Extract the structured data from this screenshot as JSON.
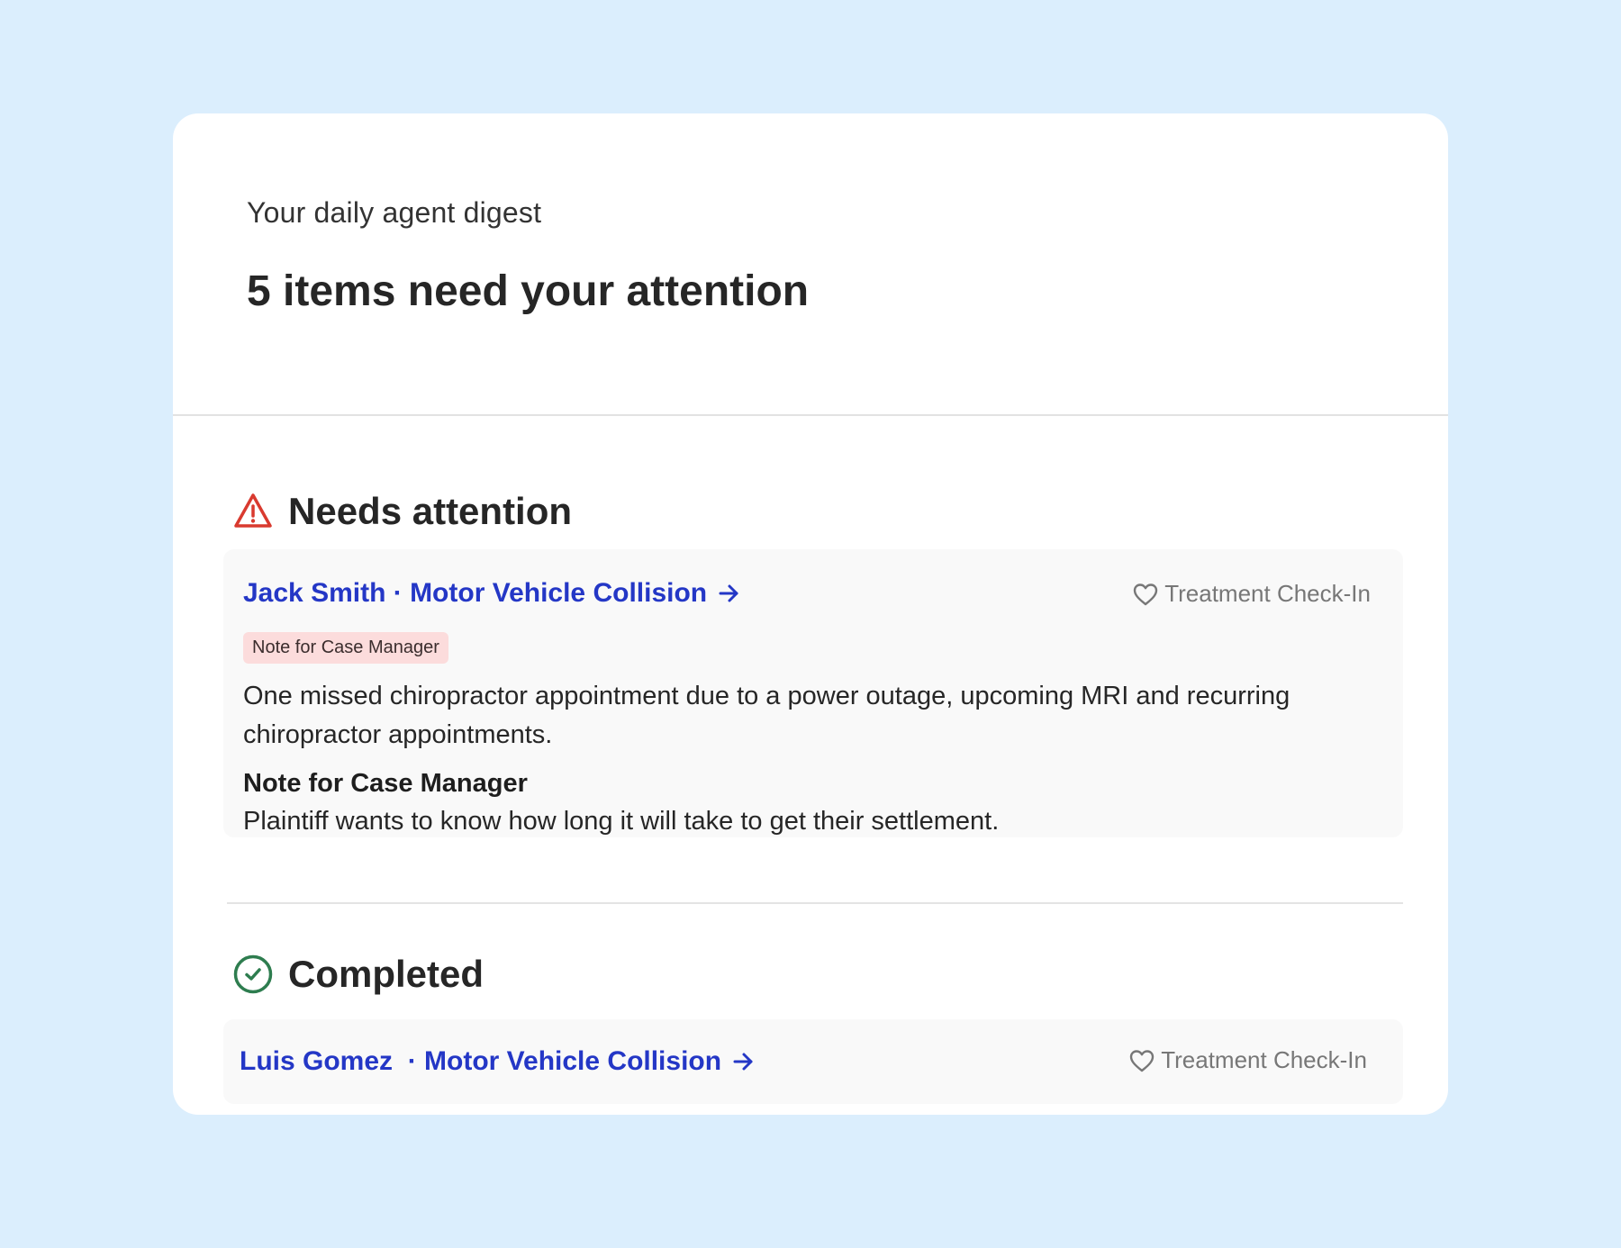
{
  "digest": {
    "subtitle": "Your daily agent digest",
    "headline": "5 items need your attention"
  },
  "sections": {
    "needs_attention": {
      "title": "Needs attention",
      "icon": "warning-triangle-icon",
      "icon_color": "#d93a2f",
      "item": {
        "client": "Jack Smith",
        "case_type": "Motor Vehicle Collision",
        "link_text": "Jack Smith · Motor Vehicle Collision",
        "tag": "Treatment Check-In",
        "badge": "Note for Case Manager",
        "summary": "One missed chiropractor appointment due to a power outage, upcoming MRI and recurring chiropractor appointments.",
        "note_title": "Note for Case Manager",
        "note_text": "Plaintiff wants to know how long it will take to get their settlement."
      }
    },
    "completed": {
      "title": "Completed",
      "icon": "check-circle-icon",
      "icon_color": "#2e7d4f",
      "item": {
        "client": "Luis Gomez",
        "case_type": "Motor Vehicle Collision",
        "link_text": "Luis Gomez  · Motor Vehicle Collision",
        "tag": "Treatment Check-In"
      }
    }
  },
  "colors": {
    "background": "#dbeefd",
    "card": "#ffffff",
    "link": "#2437c6",
    "badge_bg": "#fcdcdc",
    "item_bg": "#f9f9f9"
  }
}
